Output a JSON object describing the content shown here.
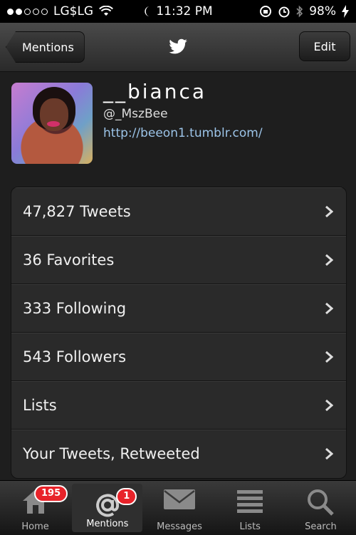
{
  "status_bar": {
    "carrier": "LG$LG",
    "time": "11:32 PM",
    "battery": "98%",
    "signal_bars_on": 2,
    "signal_bars_total": 5
  },
  "nav": {
    "back_label": "Mentions",
    "edit_label": "Edit",
    "logo_icon": "twitter-bird-icon"
  },
  "profile": {
    "display_name": "__bianca",
    "username": "@_MszBee",
    "url": "http://beeon1.tumblr.com/"
  },
  "menu": {
    "items": [
      {
        "label": "47,827 Tweets"
      },
      {
        "label": "36 Favorites"
      },
      {
        "label": "333 Following"
      },
      {
        "label": "543 Followers"
      },
      {
        "label": "Lists"
      },
      {
        "label": "Your Tweets, Retweeted"
      }
    ]
  },
  "tabs": [
    {
      "label": "Home",
      "badge": "195",
      "icon": "home-icon"
    },
    {
      "label": "Mentions",
      "badge": "1",
      "icon": "at-icon",
      "active": true
    },
    {
      "label": "Messages",
      "badge": "",
      "icon": "envelope-icon"
    },
    {
      "label": "Lists",
      "badge": "",
      "icon": "list-icon"
    },
    {
      "label": "Search",
      "badge": "",
      "icon": "search-icon"
    }
  ]
}
